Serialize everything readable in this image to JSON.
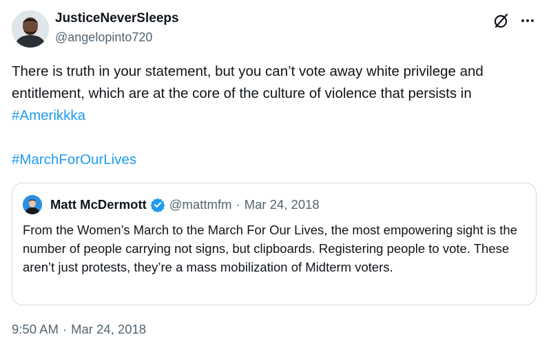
{
  "author": {
    "display_name": "JusticeNeverSleeps",
    "handle": "@angelopinto720"
  },
  "header_icons": {
    "grok": "grok-icon",
    "more": "more-icon"
  },
  "tweet": {
    "text_before_hashtag": "There is truth in your statement, but you can’t vote away white privilege and entitlement, which are at the core of the culture of violence that persists in ",
    "hashtag_1": "#Amerikkka",
    "hashtag_2": "#MarchForOurLives"
  },
  "quoted_tweet": {
    "display_name": "Matt McDermott",
    "verified": true,
    "handle": "@mattmfm",
    "separator": "·",
    "date": "Mar 24, 2018",
    "text": "From the Women’s March to the March For Our Lives, the most empowering sight is the number of people carrying not signs, but clipboards. Registering people to vote. These aren’t just protests, they’re a mass mobilization of Midterm voters."
  },
  "timestamp": {
    "time": "9:50 AM",
    "separator": "·",
    "date": "Mar 24, 2018"
  },
  "colors": {
    "link": "#1d9bf0",
    "secondary_text": "#536471",
    "primary_text": "#0f1419",
    "border": "#cfd9de"
  }
}
